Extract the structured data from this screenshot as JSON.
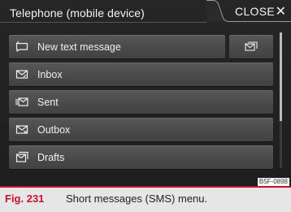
{
  "header": {
    "title": "Telephone (mobile device)",
    "close_label": "CLOSE",
    "close_glyph": "✕"
  },
  "menu": {
    "items": [
      {
        "label": "New text message",
        "icon": "compose-message-icon"
      },
      {
        "label": "Inbox",
        "icon": "inbox-envelope-icon"
      },
      {
        "label": "Sent",
        "icon": "sent-envelope-icon"
      },
      {
        "label": "Outbox",
        "icon": "outbox-envelope-icon"
      },
      {
        "label": "Drafts",
        "icon": "drafts-envelope-icon"
      }
    ],
    "side_button_icon": "message-folder-icon"
  },
  "scrollbar": {
    "visible_fraction": 0.65
  },
  "image_code": "B5F-0898",
  "caption": {
    "fig_number": "Fig. 231",
    "text": "Short messages (SMS) menu."
  },
  "colors": {
    "screen_bg": "#222222",
    "button_bg": "#4e4e4e",
    "text": "#f0f0f0",
    "caption_accent": "#c8102e",
    "caption_bg": "#e6e6e6"
  }
}
